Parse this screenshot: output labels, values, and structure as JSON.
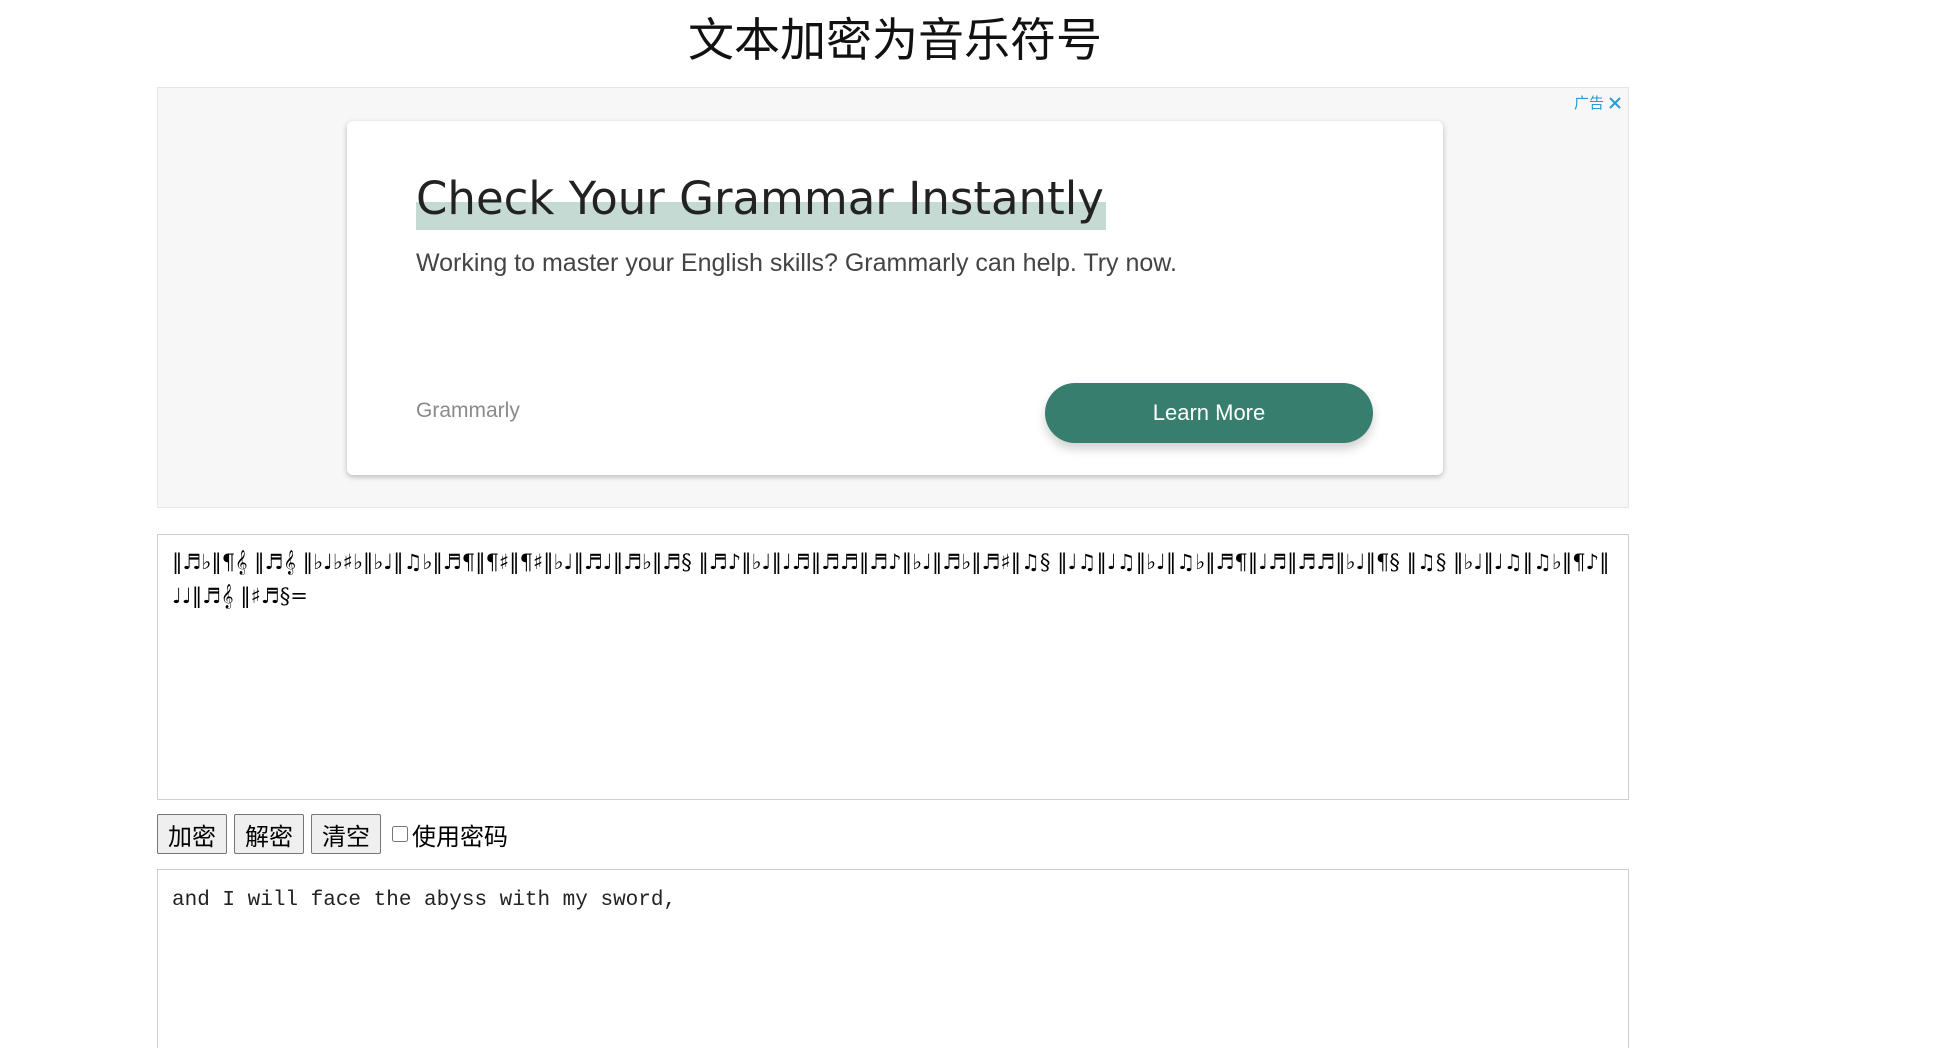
{
  "page": {
    "title": "文本加密为音乐符号"
  },
  "ad": {
    "choices_label": "广告",
    "headline": "Check Your Grammar Instantly",
    "body": "Working to master your English skills? Grammarly can help. Try now.",
    "brand": "Grammarly",
    "cta_label": "Learn More",
    "accent_color": "#377e6f",
    "highlight_color": "#c5dad3"
  },
  "cipher": {
    "value": "‖♬♭‖¶𝄞 ‖♬𝄞 ‖♭♩♭♯♭‖♭♩‖♫♭‖♬¶‖¶♯‖¶♯‖♭♩‖♬♩‖♬♭‖♬§ ‖♬♪‖♭♩‖♩♬‖♬♬‖♬♪‖♭♩‖♬♭‖♬♯‖♫§ ‖♩♫‖♩♫‖♭♩‖♫♭‖♬¶‖♩♬‖♬♬‖♭♩‖¶§ ‖♫§ ‖♭♩‖♩♫‖♫♭‖¶♪‖♩♩‖♬𝄞 ‖♯♬§="
  },
  "controls": {
    "encrypt_label": "加密",
    "decrypt_label": "解密",
    "clear_label": "清空",
    "use_password_label": "使用密码",
    "use_password_checked": false
  },
  "plain": {
    "value": "and I will face the abyss with my sword,"
  }
}
